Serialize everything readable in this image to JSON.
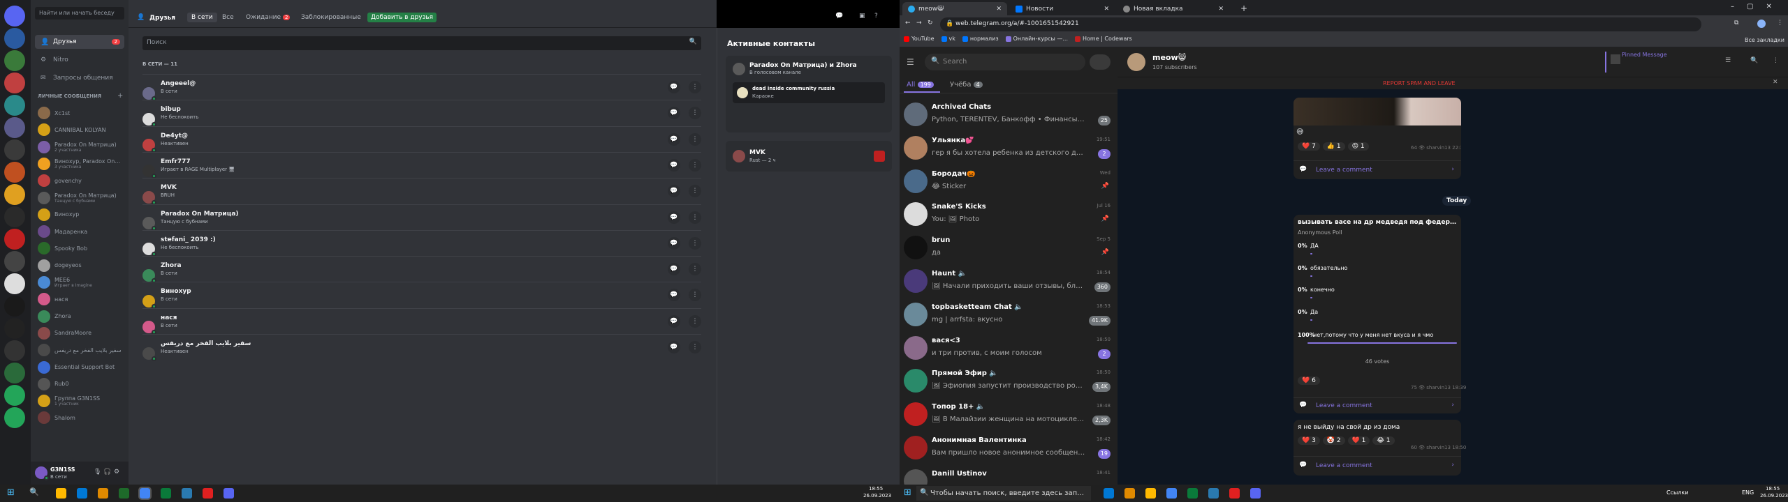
{
  "discord": {
    "search_placeholder": "Найти или начать беседу",
    "nav": {
      "friends": "Друзья",
      "friends_badge": "2",
      "nitro": "Nitro",
      "requests": "Запросы общения"
    },
    "dm_header": "ЛИЧНЫЕ СООБЩЕНИЯ",
    "dms": [
      {
        "name": "Xc1st",
        "sub": "",
        "color": "#8a6a4a"
      },
      {
        "name": "CANNIBAL KOLYAN",
        "sub": "",
        "color": "#d4a017"
      },
      {
        "name": "Paradox On Матрица)",
        "sub": "2 участника",
        "color": "#7b5ea7"
      },
      {
        "name": "Винохур, Paradox On ...",
        "sub": "3 участника",
        "color": "#f0a020"
      },
      {
        "name": "govenchy",
        "sub": "",
        "color": "#c04040"
      },
      {
        "name": "Paradox On Матрица)",
        "sub": "Танцую с бубнами",
        "color": "#5a5a5a"
      },
      {
        "name": "Винохур",
        "sub": "",
        "color": "#d4a017"
      },
      {
        "name": "Мадаренка",
        "sub": "",
        "color": "#6a4a8a"
      },
      {
        "name": "Spooky Bob",
        "sub": "",
        "color": "#2a6a2a"
      },
      {
        "name": "dogeyeos",
        "sub": "",
        "color": "#a0a0a0"
      },
      {
        "name": "MEE6",
        "sub": "Играет в Imagine",
        "color": "#4a8ad4"
      },
      {
        "name": "нася",
        "sub": "",
        "color": "#d45a8a"
      },
      {
        "name": "Zhora",
        "sub": "",
        "color": "#3a8a5a"
      },
      {
        "name": "SandraMoore",
        "sub": "",
        "color": "#8a4a4a"
      },
      {
        "name": "سفیر بلایب الفخر مع دریفس",
        "sub": "",
        "color": "#4a4a4a"
      },
      {
        "name": "Essential Support Bot",
        "sub": "",
        "color": "#3a6ad4"
      },
      {
        "name": "Rub0",
        "sub": "",
        "color": "#555"
      },
      {
        "name": "Группа G3N1SS",
        "sub": "1 участник",
        "color": "#d4a017"
      },
      {
        "name": "Shalom",
        "sub": "",
        "color": "#6a3a3a"
      }
    ],
    "user": {
      "name": "G3N1SS",
      "status": "В сети"
    },
    "header": {
      "friends": "Друзья",
      "online": "В сети",
      "all": "Все",
      "pending": "Ожидание",
      "pending_badge": "2",
      "blocked": "Заблокированные",
      "add": "Добавить в друзья"
    },
    "search": "Поиск",
    "online_count": "В СЕТИ — 11",
    "friends": [
      {
        "name": "Angeeel@",
        "sub": "В сети",
        "color": "#6a6a8a"
      },
      {
        "name": "bibup",
        "sub": "Не беспокоить",
        "color": "#dcdcdc"
      },
      {
        "name": "De4yt@",
        "sub": "Неактивен",
        "color": "#c04040"
      },
      {
        "name": "Emfr777",
        "sub": "Играет в RAGE Multiplayer 🖥",
        "color": "#333"
      },
      {
        "name": "MVK",
        "sub": "BRUH",
        "color": "#8a4a4a"
      },
      {
        "name": "Paradox On Матрица)",
        "sub": "Танцую с бубнами",
        "color": "#5a5a5a"
      },
      {
        "name": "stefani_ 2039 :)",
        "sub": "Не беспокоить",
        "color": "#ddd"
      },
      {
        "name": "Zhora",
        "sub": "В сети",
        "color": "#3a8a5a"
      },
      {
        "name": "Винохур",
        "sub": "В сети",
        "color": "#d4a017"
      },
      {
        "name": "нася",
        "sub": "В сети",
        "color": "#d45a8a"
      },
      {
        "name": "سفیر بلایب الفخر مع دریفس",
        "sub": "Неактивен",
        "color": "#4a4a4a"
      }
    ],
    "active": {
      "title": "Активные контакты",
      "card1_title": "Paradox On Матрица) и Zhora",
      "card1_sub": "В голосовом канале",
      "card1_server": "dead inside community russia",
      "card1_ch": "Караоке",
      "card2_title": "MVK",
      "card2_sub": "Rust — 2 ч"
    }
  },
  "chrome": {
    "tabs": [
      "meow😸",
      "Новости",
      "Новая вкладка"
    ],
    "url": "web.telegram.org/a/#-1001651542921",
    "bookmarks": [
      "YouTube",
      "vk",
      "нормализ",
      "Онлайн-курсы —...",
      "Home | Codewars"
    ],
    "all_bookmarks": "Все закладки"
  },
  "telegram": {
    "search": "Search",
    "folders": [
      {
        "label": "All",
        "badge": "199"
      },
      {
        "label": "Учёба",
        "badge": "4"
      }
    ],
    "chats": [
      {
        "name": "Archived Chats",
        "msg": "Python, TERENTEV, Банкофф • Финансы, Блог ...",
        "time": "",
        "badge": "25",
        "color": "#5f6b7a"
      },
      {
        "name": "Ульянка💕",
        "msg": "гер я бы хотела ребенка из детского дома взя...",
        "time": "19:51",
        "badge": "2",
        "color": "#b08060"
      },
      {
        "name": "Бородач🎃",
        "msg": "😂 Sticker",
        "time": "Wed",
        "badge": "",
        "color": "#4a6a8a"
      },
      {
        "name": "Snake'S Kicks",
        "msg": "You: 🖼 Photo",
        "time": "Jul 16",
        "badge": "",
        "color": "#dcdcdc"
      },
      {
        "name": "brun",
        "msg": "да",
        "time": "Sep 5",
        "badge": "",
        "color": "#111"
      },
      {
        "name": "Haunt 🔈",
        "msg": "🖼 Начали приходить ваши отзывы, благод...",
        "time": "18:54",
        "badge": "360",
        "color": "#4a3a7a"
      },
      {
        "name": "topbasketteam Chat 🔈",
        "msg": "mg | arrfsta: вкусно",
        "time": "18:53",
        "badge": "41.9K",
        "color": "#6a8a9a"
      },
      {
        "name": "вася<3",
        "msg": "и три против, с моим голосом",
        "time": "18:50",
        "badge": "2",
        "color": "#8a6a8a"
      },
      {
        "name": "Прямой Эфир 🔈",
        "msg": "🖼 Эфиопия запустит производство росси...",
        "time": "18:50",
        "badge": "3,4K",
        "color": "#2a8a6a"
      },
      {
        "name": "Топор 18+ 🔈",
        "msg": "🖼 В Малайзии женщина на мотоцикле с п...",
        "time": "18:48",
        "badge": "2,3K",
        "color": "#c02020"
      },
      {
        "name": "Анонимная Валентинка",
        "msg": "Вам пришло новое анонимное сообщение от...",
        "time": "18:42",
        "badge": "19",
        "color": "#a02020"
      },
      {
        "name": "Danill Ustinov",
        "msg": "",
        "time": "18:41",
        "badge": "",
        "color": "#555"
      }
    ],
    "channel": {
      "name": "meow😸",
      "subs": "107 subscribers"
    },
    "pinned": {
      "title": "Pinned Message",
      "sub": ""
    },
    "spam": "REPORT SPAM AND LEAVE",
    "msg1": {
      "reactions": [
        "❤️ 7",
        "👍 1",
        "😡 1"
      ],
      "meta": "64 👁 sharvin13 22:37",
      "comment": "Leave a comment"
    },
    "day": "Today",
    "poll": {
      "question": "вызывать васе на др медведя под федерико?",
      "type": "Anonymous Poll",
      "options": [
        {
          "pct": "0%",
          "text": "ДА"
        },
        {
          "pct": "0%",
          "text": "обязательно"
        },
        {
          "pct": "0%",
          "text": "конечно"
        },
        {
          "pct": "0%",
          "text": "Да"
        },
        {
          "pct": "100%",
          "text": "нет,потому что у меня нет вкуса и я чмо"
        }
      ],
      "votes": "46 votes",
      "reaction": "❤️ 6",
      "meta": "75 👁 sharvin13 18:39",
      "comment": "Leave a comment"
    },
    "msg3": {
      "text": "я не выйду на свой др из дома",
      "reactions": [
        "❤️ 3",
        "🤡 2",
        "❤️ 1",
        "😂 1"
      ],
      "meta": "60 👁 sharvin13 18:50",
      "comment": "Leave a comment"
    }
  },
  "taskbar": {
    "left_time": "18:55",
    "left_date": "26.09.2023",
    "right_search": "Чтобы начать поиск, введите здесь запрос",
    "right_links": "Ссылки",
    "right_lang": "ENG",
    "right_time": "18:55",
    "right_date": "26.09.2023"
  }
}
